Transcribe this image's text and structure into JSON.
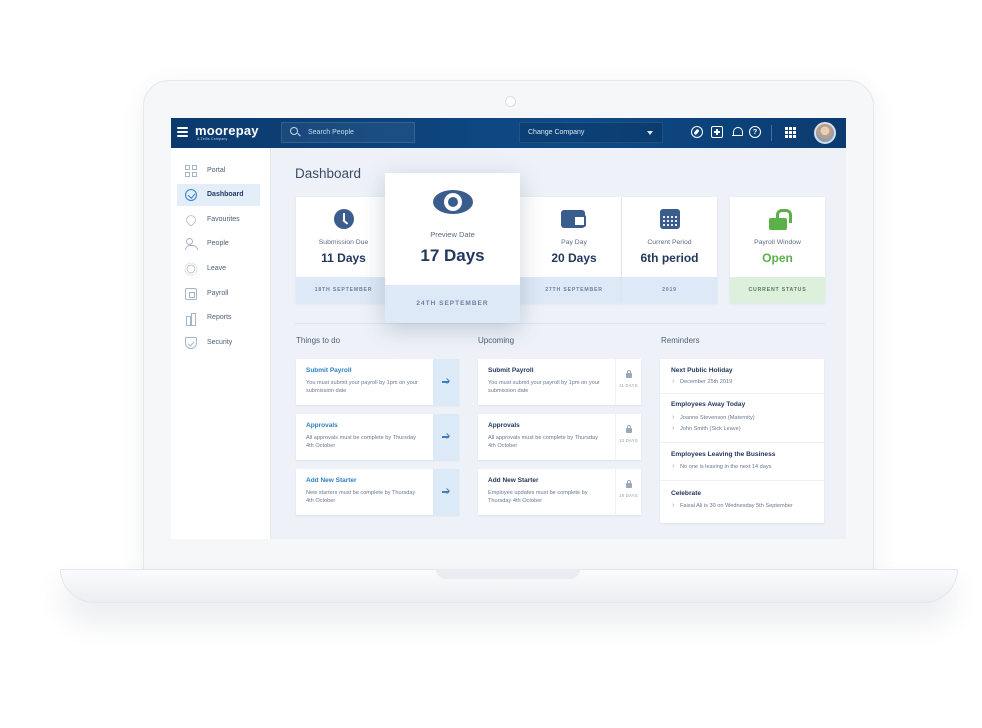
{
  "header": {
    "logo": "moorepay",
    "logo_sub": "A Zellis Company",
    "search_placeholder": "Search People",
    "company_select": "Change Company"
  },
  "sidebar": {
    "items": [
      {
        "label": "Portal",
        "icon": "grid-icon"
      },
      {
        "label": "Dashboard",
        "icon": "dashboard-icon",
        "active": true
      },
      {
        "label": "Favourites",
        "icon": "heart-icon"
      },
      {
        "label": "People",
        "icon": "people-icon"
      },
      {
        "label": "Leave",
        "icon": "sun-icon"
      },
      {
        "label": "Payroll",
        "icon": "wallet-icon"
      },
      {
        "label": "Reports",
        "icon": "bar-chart-icon"
      },
      {
        "label": "Security",
        "icon": "shield-icon"
      }
    ]
  },
  "main": {
    "title": "Dashboard",
    "cards": [
      {
        "label": "Submission Due",
        "value": "11 Days",
        "footer": "18TH SEPTEMBER",
        "icon": "clock-icon"
      },
      {
        "label": "Preview Date",
        "value": "17 Days",
        "footer": "24TH SEPTEMBER",
        "icon": "eye-icon"
      },
      {
        "label": "Pay Day",
        "value": "20 Days",
        "footer": "27TH SEPTEMBER",
        "icon": "wallet-icon"
      },
      {
        "label": "Current Period",
        "value": "6th period",
        "footer": "2019",
        "icon": "calendar-icon"
      },
      {
        "label": "Payroll Window",
        "value": "Open",
        "footer": "CURRENT STATUS",
        "icon": "unlock-icon"
      }
    ],
    "things_to_do": {
      "title": "Things to do",
      "items": [
        {
          "title": "Submit Payroll",
          "desc": "You must submit your payroll by 1pm on your submission date"
        },
        {
          "title": "Approvals",
          "desc": "All approvals must be complete by Thursday 4th October"
        },
        {
          "title": "Add New Starter",
          "desc": "New starters must be complete by Thursday 4th October"
        }
      ]
    },
    "upcoming": {
      "title": "Upcoming",
      "items": [
        {
          "title": "Submit Payroll",
          "desc": "You must submit your payroll by 1pm on your submission date",
          "days": "11 DAYS"
        },
        {
          "title": "Approvals",
          "desc": "All approvals must be complete by Thursday 4th October",
          "days": "13 DAYS"
        },
        {
          "title": "Add New Starter",
          "desc": "Employee updates must be complete by Thursday 4th October",
          "days": "18 DAYS"
        }
      ]
    },
    "reminders": {
      "title": "Reminders",
      "groups": [
        {
          "title": "Next Public Holiday",
          "items": [
            "December 25th 2019"
          ]
        },
        {
          "title": "Employees Away Today",
          "items": [
            "Joanne Stevenson (Maternity)",
            "John Smith (Sick Leave)"
          ]
        },
        {
          "title": "Employees Leaving the Business",
          "items": [
            "No one is leaving in the next 14 days"
          ]
        },
        {
          "title": "Celebrate",
          "items": [
            "Faisal Ali is 30 on Wednesday 5th September"
          ]
        }
      ]
    }
  },
  "colors": {
    "header_bg": "#0e4a86",
    "accent": "#2d7fc1",
    "icon": "#3a5d8d",
    "open_green": "#5cb04a"
  }
}
